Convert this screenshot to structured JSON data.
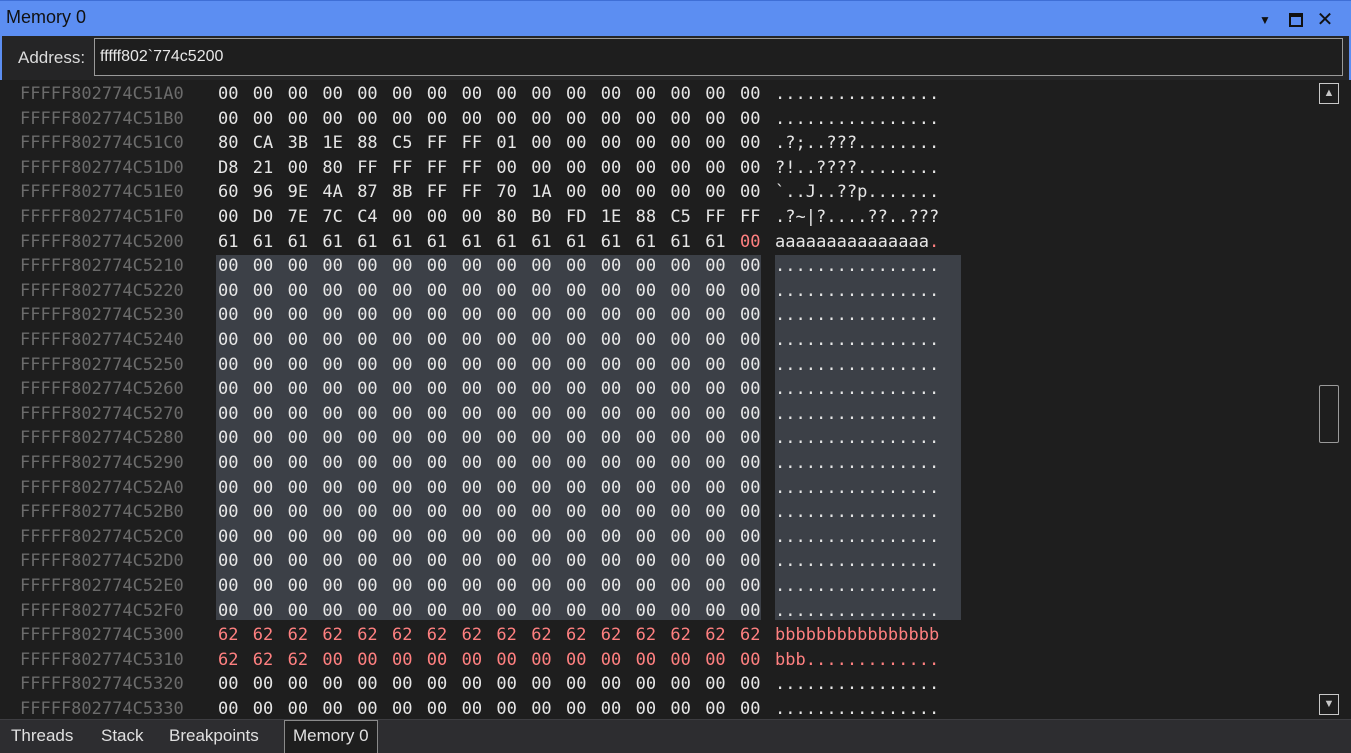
{
  "window": {
    "title": "Memory 0"
  },
  "address_bar": {
    "label": "Address:",
    "value": "fffff802`774c5200"
  },
  "memory": {
    "rows": [
      {
        "address": "FFFFF802774C51A0",
        "bytes": [
          "00",
          "00",
          "00",
          "00",
          "00",
          "00",
          "00",
          "00",
          "00",
          "00",
          "00",
          "00",
          "00",
          "00",
          "00",
          "00"
        ],
        "ascii": "................",
        "changed": []
      },
      {
        "address": "FFFFF802774C51B0",
        "bytes": [
          "00",
          "00",
          "00",
          "00",
          "00",
          "00",
          "00",
          "00",
          "00",
          "00",
          "00",
          "00",
          "00",
          "00",
          "00",
          "00"
        ],
        "ascii": "................",
        "changed": []
      },
      {
        "address": "FFFFF802774C51C0",
        "bytes": [
          "80",
          "CA",
          "3B",
          "1E",
          "88",
          "C5",
          "FF",
          "FF",
          "01",
          "00",
          "00",
          "00",
          "00",
          "00",
          "00",
          "00"
        ],
        "ascii": ".?;..???........",
        "changed": []
      },
      {
        "address": "FFFFF802774C51D0",
        "bytes": [
          "D8",
          "21",
          "00",
          "80",
          "FF",
          "FF",
          "FF",
          "FF",
          "00",
          "00",
          "00",
          "00",
          "00",
          "00",
          "00",
          "00"
        ],
        "ascii": "?!..????........",
        "changed": []
      },
      {
        "address": "FFFFF802774C51E0",
        "bytes": [
          "60",
          "96",
          "9E",
          "4A",
          "87",
          "8B",
          "FF",
          "FF",
          "70",
          "1A",
          "00",
          "00",
          "00",
          "00",
          "00",
          "00"
        ],
        "ascii": "`..J..??p.......",
        "changed": []
      },
      {
        "address": "FFFFF802774C51F0",
        "bytes": [
          "00",
          "D0",
          "7E",
          "7C",
          "C4",
          "00",
          "00",
          "00",
          "80",
          "B0",
          "FD",
          "1E",
          "88",
          "C5",
          "FF",
          "FF"
        ],
        "ascii": ".?~|?....??..???",
        "changed": []
      },
      {
        "address": "FFFFF802774C5200",
        "bytes": [
          "61",
          "61",
          "61",
          "61",
          "61",
          "61",
          "61",
          "61",
          "61",
          "61",
          "61",
          "61",
          "61",
          "61",
          "61",
          "00"
        ],
        "ascii": "aaaaaaaaaaaaaaa.",
        "changed": [
          15
        ]
      },
      {
        "address": "FFFFF802774C5210",
        "bytes": [
          "00",
          "00",
          "00",
          "00",
          "00",
          "00",
          "00",
          "00",
          "00",
          "00",
          "00",
          "00",
          "00",
          "00",
          "00",
          "00"
        ],
        "ascii": "................",
        "changed": []
      },
      {
        "address": "FFFFF802774C5220",
        "bytes": [
          "00",
          "00",
          "00",
          "00",
          "00",
          "00",
          "00",
          "00",
          "00",
          "00",
          "00",
          "00",
          "00",
          "00",
          "00",
          "00"
        ],
        "ascii": "................",
        "changed": []
      },
      {
        "address": "FFFFF802774C5230",
        "bytes": [
          "00",
          "00",
          "00",
          "00",
          "00",
          "00",
          "00",
          "00",
          "00",
          "00",
          "00",
          "00",
          "00",
          "00",
          "00",
          "00"
        ],
        "ascii": "................",
        "changed": []
      },
      {
        "address": "FFFFF802774C5240",
        "bytes": [
          "00",
          "00",
          "00",
          "00",
          "00",
          "00",
          "00",
          "00",
          "00",
          "00",
          "00",
          "00",
          "00",
          "00",
          "00",
          "00"
        ],
        "ascii": "................",
        "changed": []
      },
      {
        "address": "FFFFF802774C5250",
        "bytes": [
          "00",
          "00",
          "00",
          "00",
          "00",
          "00",
          "00",
          "00",
          "00",
          "00",
          "00",
          "00",
          "00",
          "00",
          "00",
          "00"
        ],
        "ascii": "................",
        "changed": []
      },
      {
        "address": "FFFFF802774C5260",
        "bytes": [
          "00",
          "00",
          "00",
          "00",
          "00",
          "00",
          "00",
          "00",
          "00",
          "00",
          "00",
          "00",
          "00",
          "00",
          "00",
          "00"
        ],
        "ascii": "................",
        "changed": []
      },
      {
        "address": "FFFFF802774C5270",
        "bytes": [
          "00",
          "00",
          "00",
          "00",
          "00",
          "00",
          "00",
          "00",
          "00",
          "00",
          "00",
          "00",
          "00",
          "00",
          "00",
          "00"
        ],
        "ascii": "................",
        "changed": []
      },
      {
        "address": "FFFFF802774C5280",
        "bytes": [
          "00",
          "00",
          "00",
          "00",
          "00",
          "00",
          "00",
          "00",
          "00",
          "00",
          "00",
          "00",
          "00",
          "00",
          "00",
          "00"
        ],
        "ascii": "................",
        "changed": []
      },
      {
        "address": "FFFFF802774C5290",
        "bytes": [
          "00",
          "00",
          "00",
          "00",
          "00",
          "00",
          "00",
          "00",
          "00",
          "00",
          "00",
          "00",
          "00",
          "00",
          "00",
          "00"
        ],
        "ascii": "................",
        "changed": []
      },
      {
        "address": "FFFFF802774C52A0",
        "bytes": [
          "00",
          "00",
          "00",
          "00",
          "00",
          "00",
          "00",
          "00",
          "00",
          "00",
          "00",
          "00",
          "00",
          "00",
          "00",
          "00"
        ],
        "ascii": "................",
        "changed": []
      },
      {
        "address": "FFFFF802774C52B0",
        "bytes": [
          "00",
          "00",
          "00",
          "00",
          "00",
          "00",
          "00",
          "00",
          "00",
          "00",
          "00",
          "00",
          "00",
          "00",
          "00",
          "00"
        ],
        "ascii": "................",
        "changed": []
      },
      {
        "address": "FFFFF802774C52C0",
        "bytes": [
          "00",
          "00",
          "00",
          "00",
          "00",
          "00",
          "00",
          "00",
          "00",
          "00",
          "00",
          "00",
          "00",
          "00",
          "00",
          "00"
        ],
        "ascii": "................",
        "changed": []
      },
      {
        "address": "FFFFF802774C52D0",
        "bytes": [
          "00",
          "00",
          "00",
          "00",
          "00",
          "00",
          "00",
          "00",
          "00",
          "00",
          "00",
          "00",
          "00",
          "00",
          "00",
          "00"
        ],
        "ascii": "................",
        "changed": []
      },
      {
        "address": "FFFFF802774C52E0",
        "bytes": [
          "00",
          "00",
          "00",
          "00",
          "00",
          "00",
          "00",
          "00",
          "00",
          "00",
          "00",
          "00",
          "00",
          "00",
          "00",
          "00"
        ],
        "ascii": "................",
        "changed": []
      },
      {
        "address": "FFFFF802774C52F0",
        "bytes": [
          "00",
          "00",
          "00",
          "00",
          "00",
          "00",
          "00",
          "00",
          "00",
          "00",
          "00",
          "00",
          "00",
          "00",
          "00",
          "00"
        ],
        "ascii": "................",
        "changed": []
      },
      {
        "address": "FFFFF802774C5300",
        "bytes": [
          "62",
          "62",
          "62",
          "62",
          "62",
          "62",
          "62",
          "62",
          "62",
          "62",
          "62",
          "62",
          "62",
          "62",
          "62",
          "62"
        ],
        "ascii": "bbbbbbbbbbbbbbbb",
        "changed": [
          0,
          1,
          2,
          3,
          4,
          5,
          6,
          7,
          8,
          9,
          10,
          11,
          12,
          13,
          14,
          15
        ]
      },
      {
        "address": "FFFFF802774C5310",
        "bytes": [
          "62",
          "62",
          "62",
          "00",
          "00",
          "00",
          "00",
          "00",
          "00",
          "00",
          "00",
          "00",
          "00",
          "00",
          "00",
          "00"
        ],
        "ascii": "bbb.............",
        "changed": [
          0,
          1,
          2,
          3,
          4,
          5,
          6,
          7,
          8,
          9,
          10,
          11,
          12,
          13,
          14,
          15
        ]
      },
      {
        "address": "FFFFF802774C5320",
        "bytes": [
          "00",
          "00",
          "00",
          "00",
          "00",
          "00",
          "00",
          "00",
          "00",
          "00",
          "00",
          "00",
          "00",
          "00",
          "00",
          "00"
        ],
        "ascii": "................",
        "changed": []
      },
      {
        "address": "FFFFF802774C5330",
        "bytes": [
          "00",
          "00",
          "00",
          "00",
          "00",
          "00",
          "00",
          "00",
          "00",
          "00",
          "00",
          "00",
          "00",
          "00",
          "00",
          "00"
        ],
        "ascii": "................",
        "changed": []
      }
    ],
    "selected_rows": [
      7,
      21
    ]
  },
  "tabs": [
    {
      "label": "Threads",
      "active": false
    },
    {
      "label": "Stack",
      "active": false
    },
    {
      "label": "Breakpoints",
      "active": false
    },
    {
      "label": "Memory 0",
      "active": true
    }
  ],
  "colors": {
    "titlebar": "#5c8ef2",
    "changed": "#ff8080",
    "address": "#6b6b6b",
    "selection": "#3c4047"
  },
  "icons": [
    "chevron-down-icon",
    "maximize-icon",
    "close-icon",
    "scroll-up-icon",
    "scroll-down-icon"
  ]
}
